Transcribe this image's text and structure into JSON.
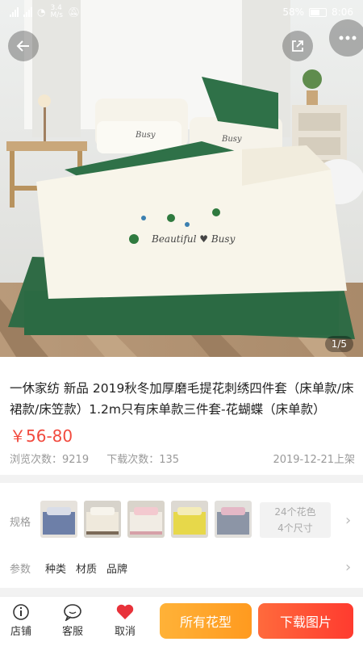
{
  "status_bar": {
    "network": "3.4\nM/s",
    "battery": "58%",
    "time": "8:06"
  },
  "hero": {
    "page_indicator": "1/5",
    "embroidery_text": "Beautiful ♥ Busy",
    "pillow_text": "Busy"
  },
  "product": {
    "title": "一休家纺 新品 2019秋冬加厚磨毛提花刺绣四件套（床单款/床裙款/床笠款）1.2m只有床单款三件套-花蝴蝶（床单款）",
    "price": "￥56-80",
    "views_label": "浏览次数：9219",
    "downloads_label": "下载次数：135",
    "date": "2019-12-21上架"
  },
  "spec": {
    "label": "规格",
    "variant_line1": "24个花色",
    "variant_line2": "4个尺寸",
    "thumbnails": [
      {
        "name": "blue",
        "color": "#6d7fa8"
      },
      {
        "name": "cream",
        "color": "#efe9dc"
      },
      {
        "name": "pink",
        "color": "#f1ece4"
      },
      {
        "name": "yellow",
        "color": "#e7d84a"
      },
      {
        "name": "gray",
        "color": "#8c95a6"
      }
    ],
    "param_label": "参数",
    "params": [
      "种类",
      "材质",
      "品牌"
    ]
  },
  "bottom_bar": {
    "shop": "店铺",
    "service": "客服",
    "cancel": "取消",
    "all_patterns": "所有花型",
    "download_images": "下载图片"
  },
  "colors": {
    "price": "#f24a3e",
    "heart": "#e8323a",
    "orange": "#ff9a1f",
    "red": "#ff3b2f"
  }
}
